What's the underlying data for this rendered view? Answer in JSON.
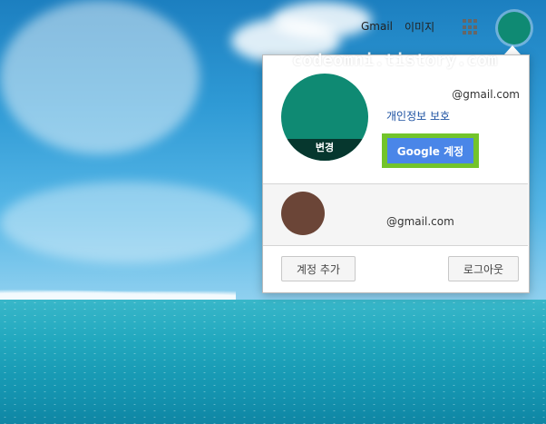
{
  "topbar": {
    "gmail_label": "Gmail",
    "images_label": "이미지",
    "apps_icon": "apps-grid-icon"
  },
  "watermark": "codeomni.tistory.com",
  "account_panel": {
    "primary": {
      "avatar_change_label": "변경",
      "email": "@gmail.com",
      "privacy_link": "개인정보 보호",
      "google_account_button": "Google 계정"
    },
    "other_account": {
      "email": "@gmail.com"
    },
    "add_account_button": "계정 추가",
    "logout_button": "로그아웃"
  },
  "colors": {
    "avatar_primary": "#0f8a73",
    "avatar_secondary": "#6b4537",
    "button_blue": "#4a86e8",
    "highlight_green": "#73c42a"
  }
}
